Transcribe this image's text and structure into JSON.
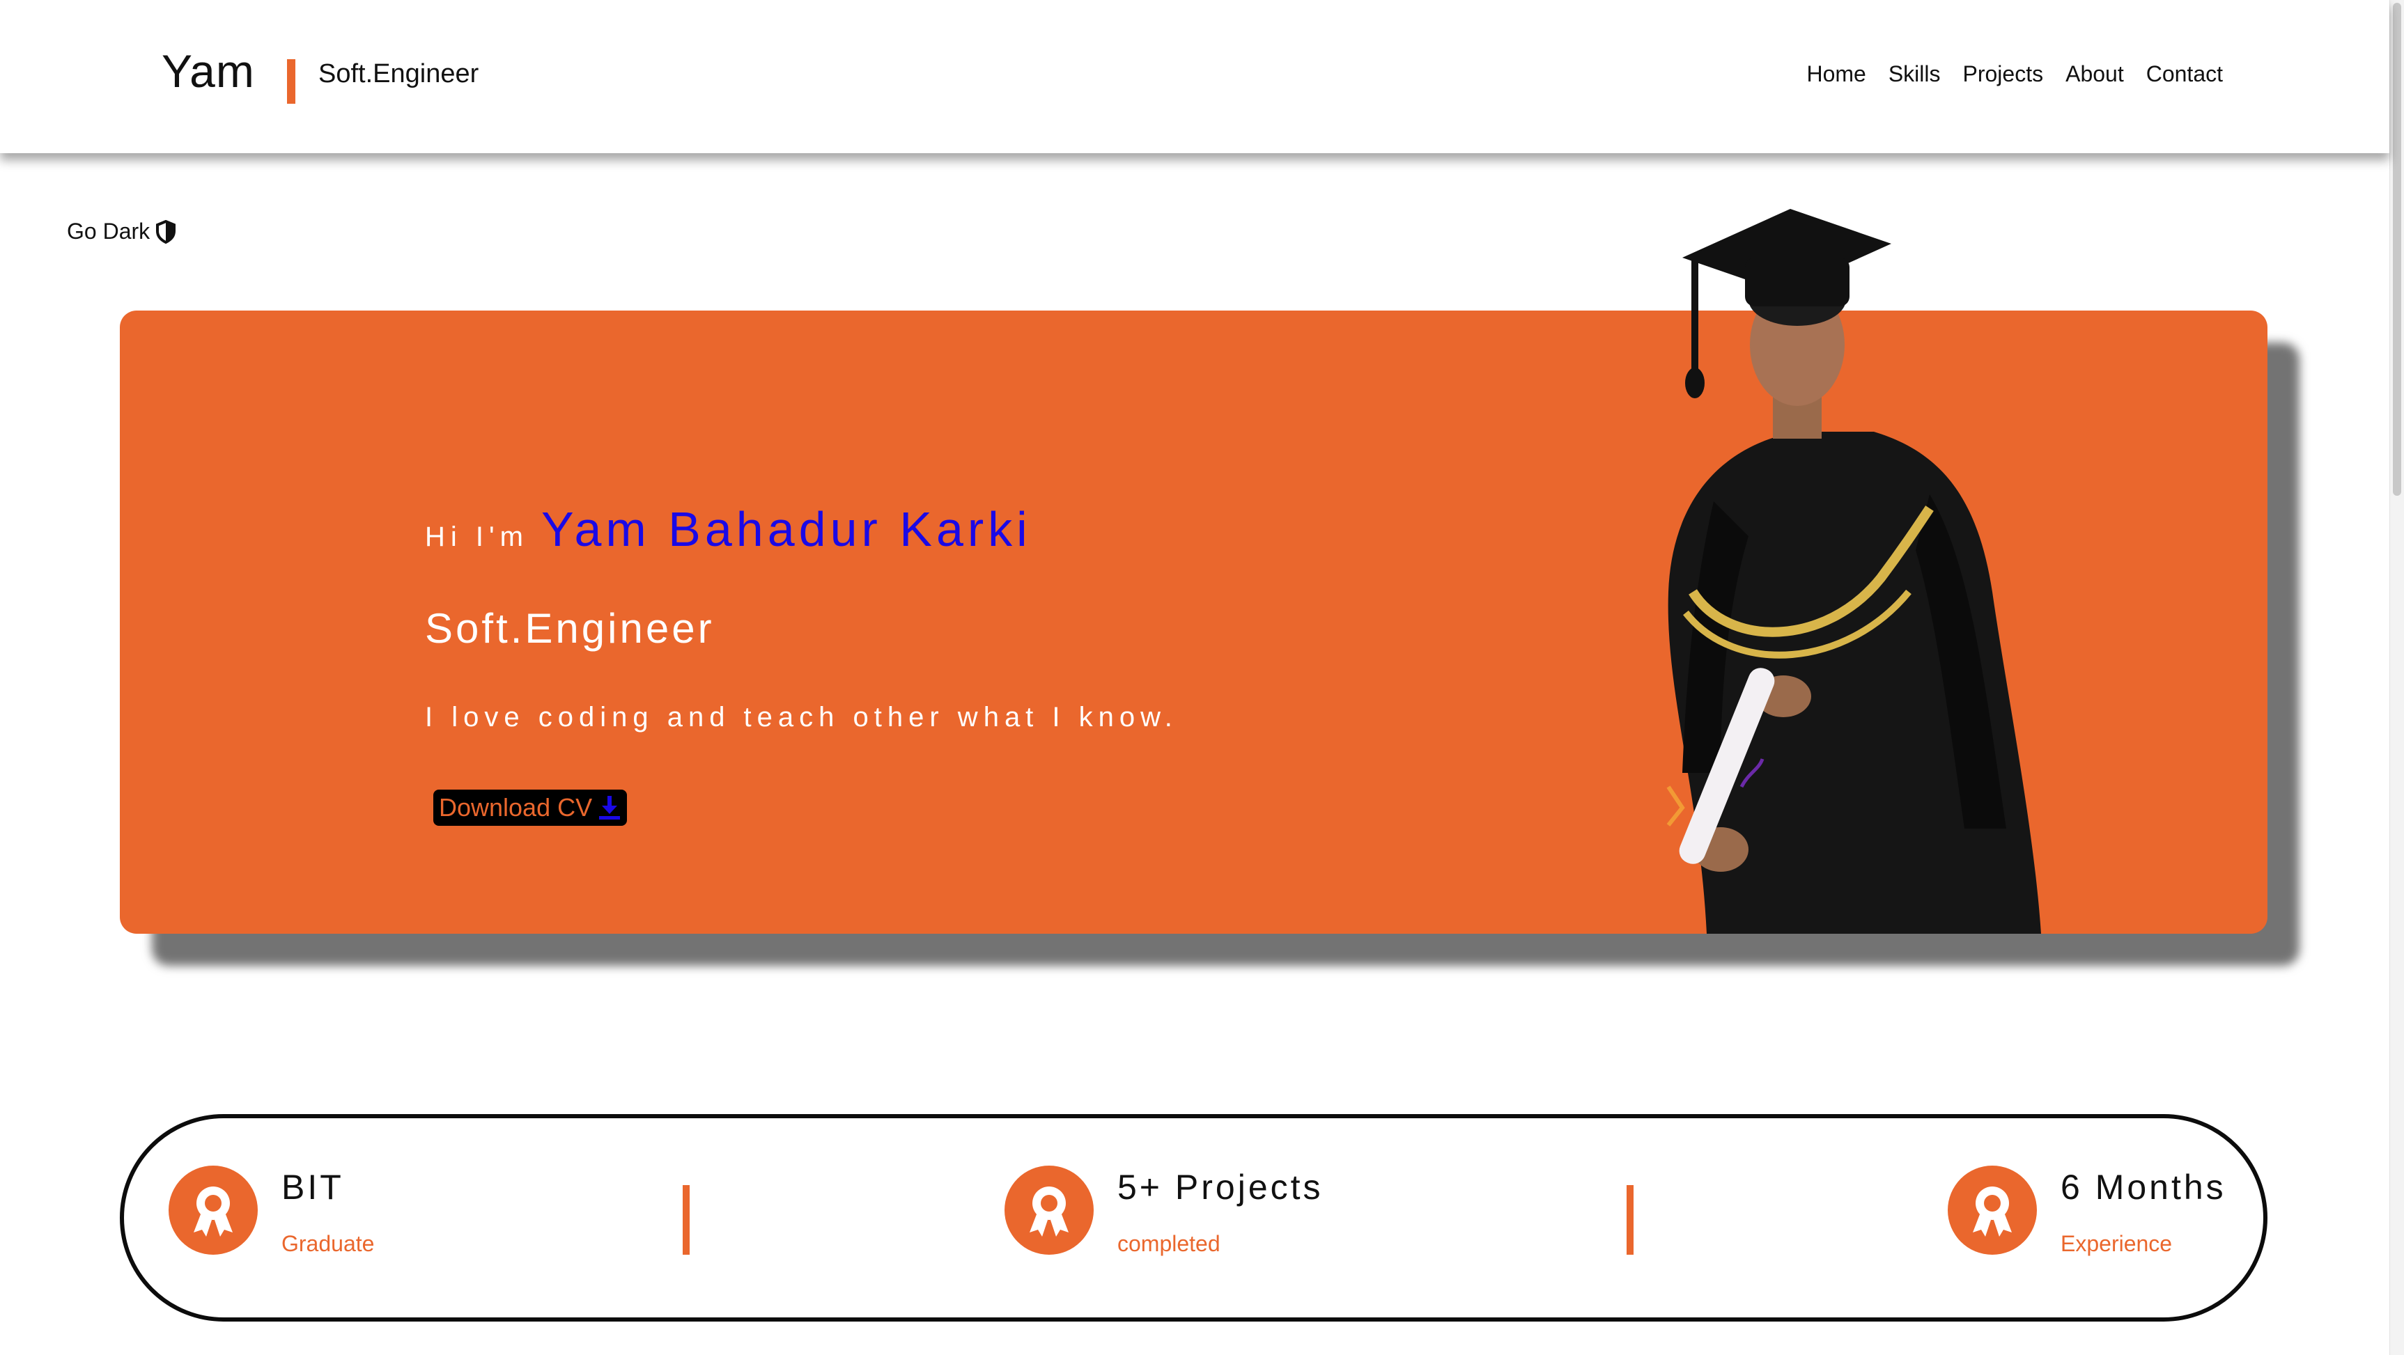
{
  "header": {
    "logo": "Yam",
    "subtitle": "Soft.Engineer",
    "nav": [
      "Home",
      "Skills",
      "Projects",
      "About",
      "Contact"
    ]
  },
  "theme_toggle": {
    "label": "Go Dark",
    "icon": "half-shield-icon"
  },
  "hero": {
    "greeting": "Hi I'm",
    "name": "Yam Bahadur Karki",
    "role": "Soft.Engineer",
    "tagline": "I love coding and teach other what I know.",
    "cta": "Download CV",
    "cta_icon": "download-icon"
  },
  "stats": [
    {
      "title": "BIT",
      "subtitle": "Graduate",
      "icon": "award-icon"
    },
    {
      "title": "5+ Projects",
      "subtitle": "completed",
      "icon": "award-icon"
    },
    {
      "title": "6 Months",
      "subtitle": "Experience",
      "icon": "award-icon"
    }
  ],
  "colors": {
    "accent": "#ea672d",
    "name_blue": "#1a09e6",
    "text": "#111111",
    "background": "#ffffff"
  }
}
